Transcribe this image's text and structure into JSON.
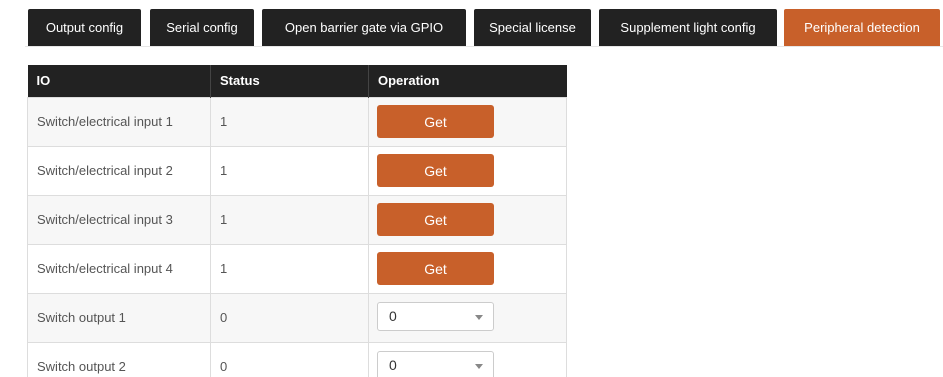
{
  "tabs": [
    {
      "label": "Output config",
      "active": false
    },
    {
      "label": "Serial config",
      "active": false
    },
    {
      "label": "Open barrier gate via GPIO",
      "active": false
    },
    {
      "label": "Special license",
      "active": false
    },
    {
      "label": "Supplement light config",
      "active": false
    },
    {
      "label": "Peripheral detection",
      "active": true
    }
  ],
  "table": {
    "headers": {
      "io": "IO",
      "status": "Status",
      "operation": "Operation"
    },
    "rows": [
      {
        "io": "Switch/electrical input 1",
        "status": "1",
        "operation": {
          "type": "button",
          "label": "Get"
        }
      },
      {
        "io": "Switch/electrical input 2",
        "status": "1",
        "operation": {
          "type": "button",
          "label": "Get"
        }
      },
      {
        "io": "Switch/electrical input 3",
        "status": "1",
        "operation": {
          "type": "button",
          "label": "Get"
        }
      },
      {
        "io": "Switch/electrical input 4",
        "status": "1",
        "operation": {
          "type": "button",
          "label": "Get"
        }
      },
      {
        "io": "Switch output 1",
        "status": "0",
        "operation": {
          "type": "select",
          "value": "0"
        }
      },
      {
        "io": "Switch output 2",
        "status": "0",
        "operation": {
          "type": "select",
          "value": "0"
        }
      }
    ]
  },
  "colors": {
    "tab_bg": "#222222",
    "tab_active_bg": "#c8602a",
    "button_bg": "#c8602a",
    "header_bg": "#222222"
  }
}
